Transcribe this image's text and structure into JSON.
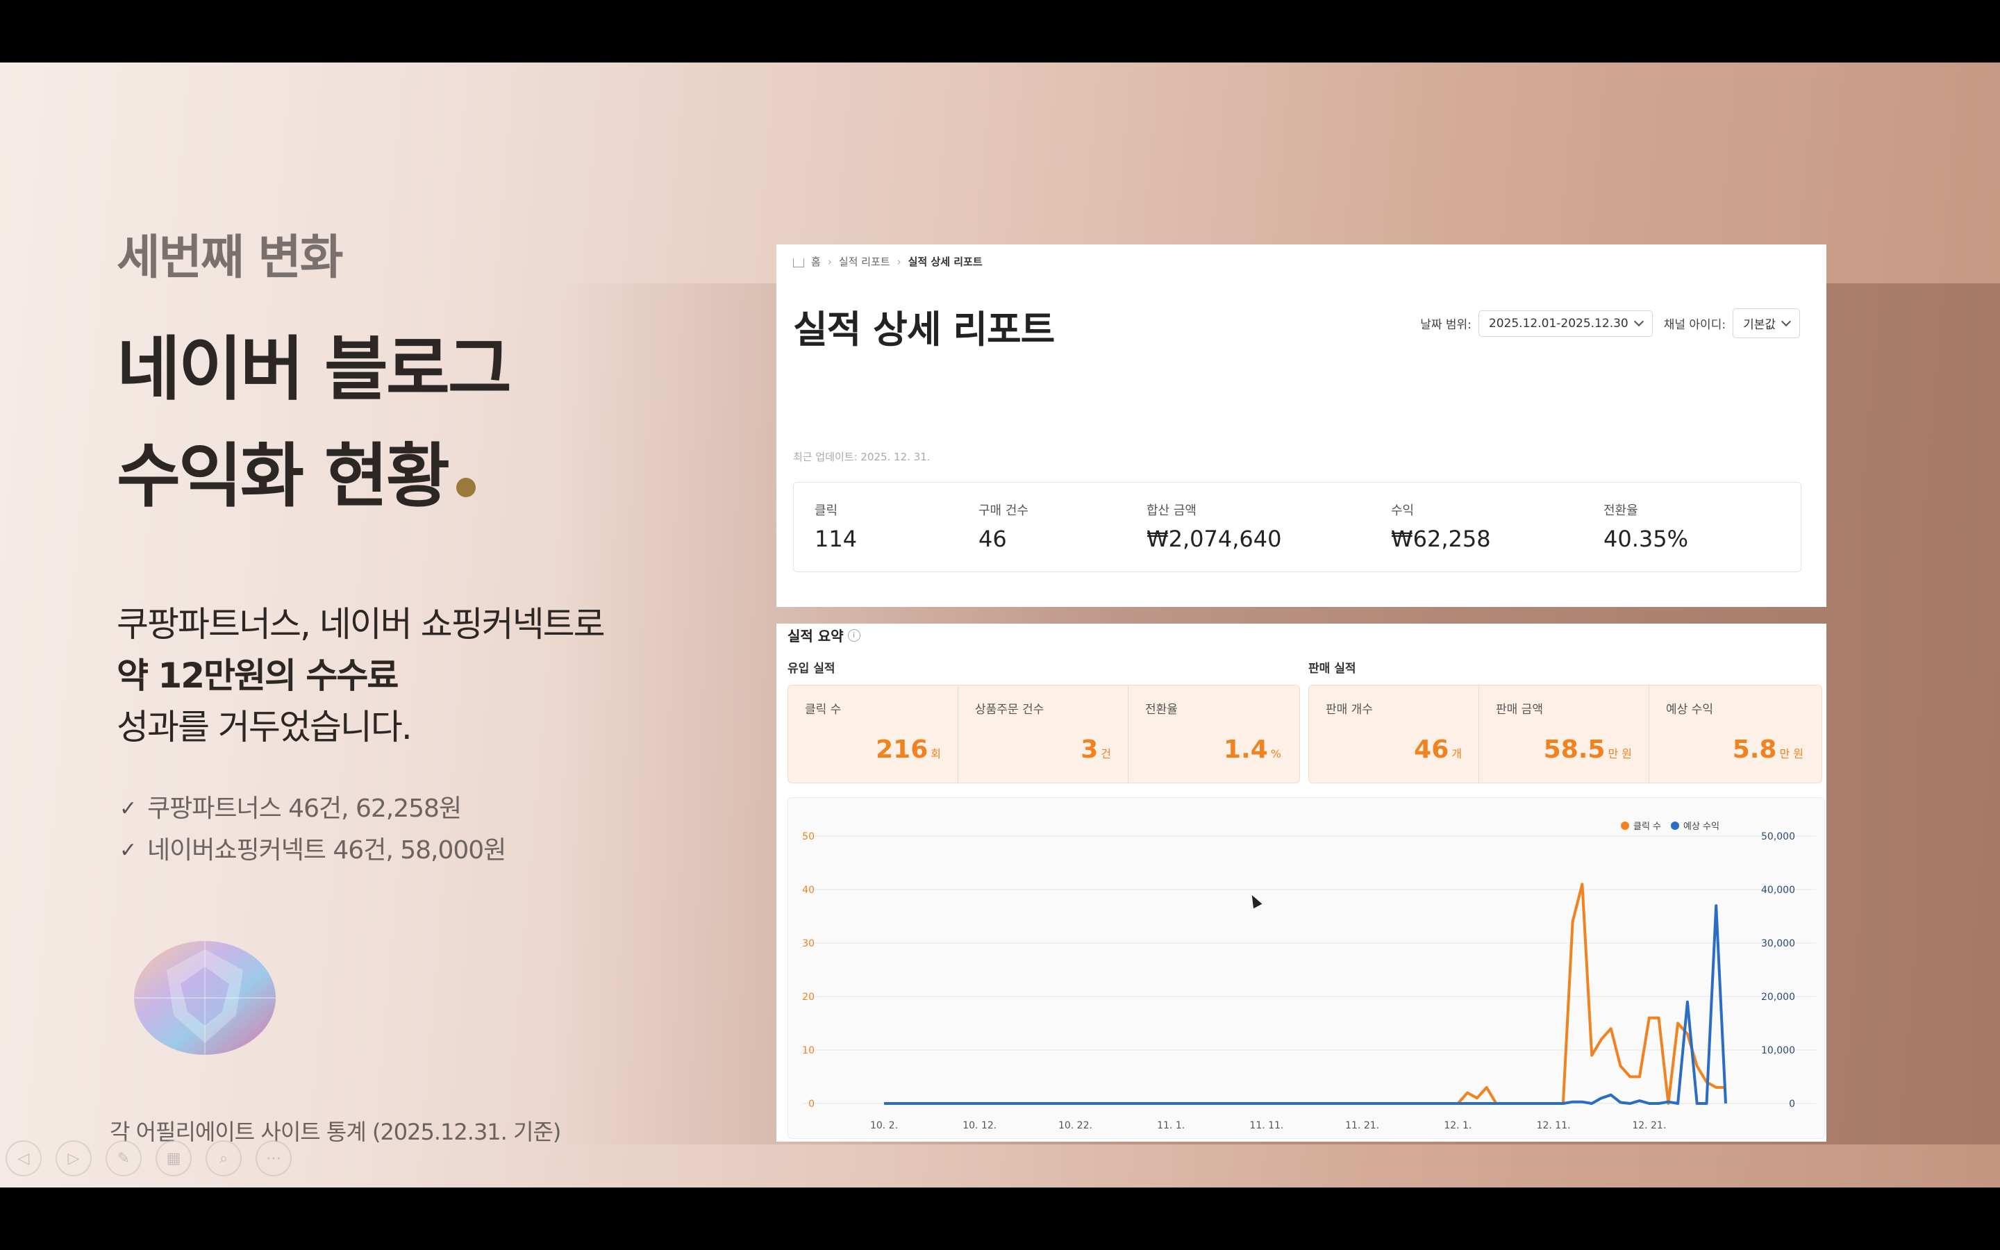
{
  "slide": {
    "kicker": "세번째 변화",
    "title_line1": "네이버 블로그",
    "title_line2": "수익화 현황",
    "subtitle_line1": "쿠팡파트너스, 네이버 쇼핑커넥트로",
    "subtitle_line2": "약 12만원의 수수료",
    "subtitle_line3": "성과를 거두었습니다.",
    "checks": [
      "쿠팡파트너스 46건, 62,258원",
      "네이버쇼핑커넥트 46건, 58,000원"
    ],
    "footnote": "각 어필리에이트 사이트 통계 (2025.12.31. 기준)"
  },
  "report": {
    "breadcrumb": [
      "홈",
      "실적 리포트",
      "실적 상세 리포트"
    ],
    "title": "실적 상세 리포트",
    "date_range_label": "날짜 범위:",
    "date_range_value": "2025.12.01-2025.12.30",
    "channel_label": "채널 아이디:",
    "channel_value": "기본값",
    "updated": "최근 업데이트: 2025. 12. 31.",
    "stats": [
      {
        "label": "클릭",
        "value": "114"
      },
      {
        "label": "구매 건수",
        "value": "46"
      },
      {
        "label": "합산 금액",
        "value": "₩2,074,640"
      },
      {
        "label": "수익",
        "value": "₩62,258"
      },
      {
        "label": "전환율",
        "value": "40.35%"
      }
    ]
  },
  "summary": {
    "title": "실적 요약",
    "inflow_label": "유입 실적",
    "sales_label": "판매 실적",
    "inflow": [
      {
        "label": "클릭 수",
        "value": "216",
        "unit": "회"
      },
      {
        "label": "상품주문 건수",
        "value": "3",
        "unit": "건"
      },
      {
        "label": "전환율",
        "value": "1.4",
        "unit": "%"
      }
    ],
    "sales": [
      {
        "label": "판매 개수",
        "value": "46",
        "unit": "개"
      },
      {
        "label": "판매 금액",
        "value": "58.5",
        "unit": "만 원"
      },
      {
        "label": "예상 수익",
        "value": "5.8",
        "unit": "만 원"
      }
    ]
  },
  "colors": {
    "orange": "#f0831f",
    "blue": "#2b6cc4"
  },
  "chart_data": {
    "type": "line",
    "x_ticks": [
      "10. 2.",
      "10. 12.",
      "10. 22.",
      "11. 1.",
      "11. 11.",
      "11. 21.",
      "12. 1.",
      "12. 11.",
      "12. 21."
    ],
    "y_left_ticks": [
      "0",
      "10",
      "20",
      "30",
      "40",
      "50"
    ],
    "y_right_ticks": [
      "0",
      "10,000",
      "20,000",
      "30,000",
      "40,000",
      "50,000"
    ],
    "ylim_left": [
      0,
      50
    ],
    "ylim_right": [
      0,
      50000
    ],
    "legend": [
      "클릭 수",
      "예상 수익"
    ],
    "legend_position": "top-right",
    "series": [
      {
        "name": "클릭 수",
        "axis": "left",
        "points": [
          [
            0,
            0
          ],
          [
            60,
            0
          ],
          [
            61,
            2
          ],
          [
            62,
            1
          ],
          [
            63,
            3
          ],
          [
            64,
            0
          ],
          [
            71,
            0
          ],
          [
            72,
            34
          ],
          [
            73,
            41
          ],
          [
            74,
            9
          ],
          [
            75,
            12
          ],
          [
            76,
            14
          ],
          [
            77,
            7
          ],
          [
            78,
            5
          ],
          [
            79,
            5
          ],
          [
            80,
            16
          ],
          [
            81,
            16
          ],
          [
            82,
            0
          ],
          [
            83,
            15
          ],
          [
            84,
            13
          ],
          [
            85,
            7
          ],
          [
            86,
            4
          ],
          [
            87,
            3
          ],
          [
            88,
            3
          ]
        ]
      },
      {
        "name": "예상 수익",
        "axis": "right",
        "points": [
          [
            0,
            0
          ],
          [
            71,
            0
          ],
          [
            72,
            300
          ],
          [
            73,
            300
          ],
          [
            74,
            0
          ],
          [
            75,
            1000
          ],
          [
            76,
            1600
          ],
          [
            77,
            200
          ],
          [
            78,
            0
          ],
          [
            79,
            500
          ],
          [
            80,
            0
          ],
          [
            81,
            0
          ],
          [
            82,
            300
          ],
          [
            83,
            0
          ],
          [
            84,
            19000
          ],
          [
            85,
            0
          ],
          [
            86,
            0
          ],
          [
            87,
            37000
          ],
          [
            88,
            0
          ]
        ]
      }
    ]
  }
}
